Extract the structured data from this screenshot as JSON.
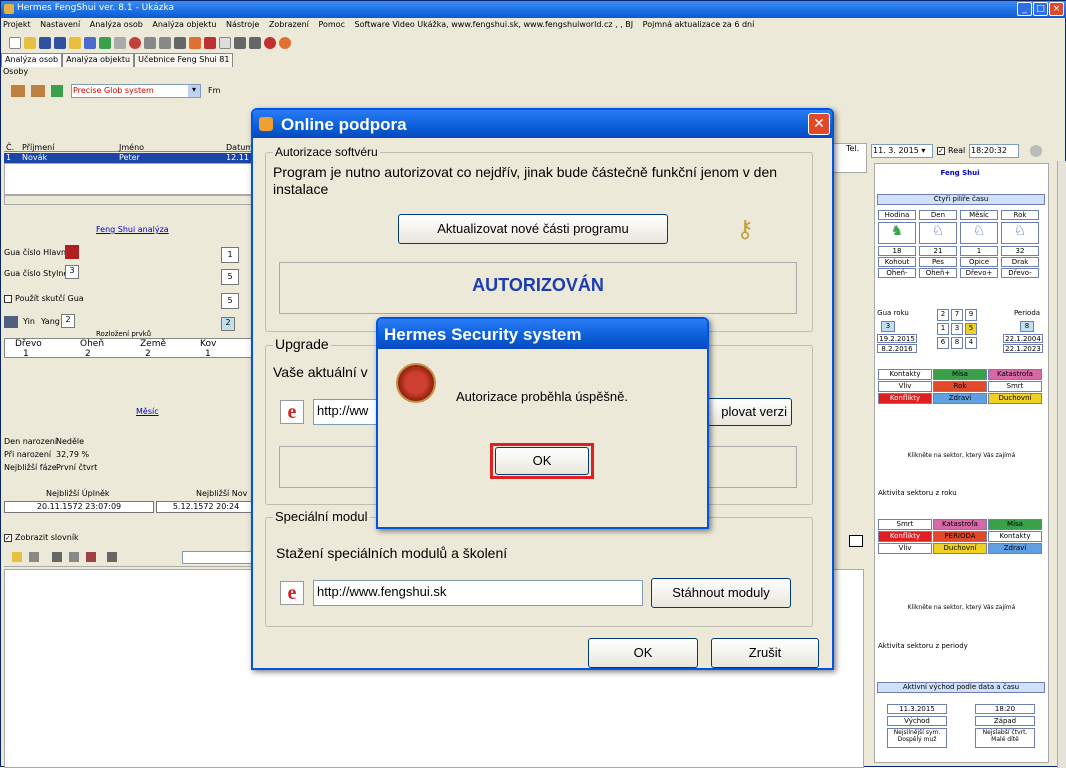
{
  "app": {
    "title": "Hermes FengShui ver. 8.1 - Ukázka",
    "menu": [
      "Projekt",
      "Nastavení",
      "Analýza osob",
      "Analýza objektu",
      "Nástroje",
      "Zobrazení",
      "Pomoc",
      "Software Video Ukážka, www.fengshui.sk, www.fengshuiworld.cz , , BJ",
      "Pojmná aktualizace za 6 dní"
    ],
    "tabs": [
      "Analýza osob",
      "Analýza objektu",
      "Učebnice Feng Shui 81"
    ],
    "group_label": "Osoby",
    "dropdown_value": "Precise Glob system",
    "fm": "Fm"
  },
  "persons": {
    "headers": [
      "Č.",
      "Příjmení",
      "Jméno",
      "Datum"
    ],
    "rows": [
      [
        "1",
        "Novák",
        "Peter",
        "12.11"
      ]
    ]
  },
  "left": {
    "fs_title": "Feng Shui analýza",
    "gua_main": "Gua číslo Hlavní",
    "gua_side": "Gua číslo Stylně",
    "gua_side_val": "3",
    "use_style": "Použít skutčí Gua",
    "yin": "Yin",
    "yang": "Yang",
    "yang_val": "2",
    "elements_label": "Rozložení prvků",
    "elements_headers": [
      "Dřevo",
      "Oheň",
      "Země",
      "Kov"
    ],
    "elements_values": [
      "1",
      "2",
      "2",
      "1"
    ],
    "side_nums": [
      "1",
      "5",
      "5",
      "2"
    ],
    "moon_title": "Měsíc",
    "day_born": "Den narození",
    "day_born_val": "Neděle",
    "at_birth": "Při narození",
    "at_birth_val": "32,79 %",
    "nearest": "Nejbližší fáze",
    "nearest_val": "První čtvrt",
    "nearest_full": "Nejbližší Úplněk",
    "nearest_new": "Nejbližší Nov",
    "full_val": "20.11.1572 23:07:09",
    "new_val": "5.12.1572 20:24",
    "show_notes": "Zobrazit slovník"
  },
  "online": {
    "title": "Online podpora",
    "auth_legend": "Autorizace softvéru",
    "auth_text": "Program je nutno autorizovat co nejdřív, jinak bude částečně funkční jenom v den instalace",
    "update_btn": "Aktualizovat nové části programu",
    "status": "AUTORIZOVÁN",
    "upgrade_legend": "Upgrade",
    "upgrade_text": "Vaše aktuální v",
    "upgrade_url": "http://ww",
    "upgrade_btn": "plovat verzi",
    "special_legend": "Speciální modul",
    "special_text": "Stažení speciálních modulů a školení",
    "special_url": "http://www.fengshui.sk",
    "download_btn": "Stáhnout moduly",
    "ok": "OK",
    "cancel": "Zrušit"
  },
  "hermes": {
    "title": "Hermes Security system",
    "message": "Autorizace proběhla úspěšně.",
    "ok": "OK"
  },
  "right": {
    "date": "11. 3. 2015",
    "real": "Real",
    "time": "18:20:32",
    "fs_title": "Feng Shui",
    "four_pillars": "Čtyři pilíře času",
    "pillar_headers": [
      "Hodina",
      "Den",
      "Měsíc",
      "Rok"
    ],
    "pillar_nums": [
      "18",
      "21",
      "1",
      "32"
    ],
    "pillar_animals": [
      "Kohout",
      "Pes",
      "Opice",
      "Drak"
    ],
    "pillar_elements": [
      "Oheň-",
      "Oheň+",
      "Dřevo+",
      "Dřevo-"
    ],
    "year_gua": "Gua roku",
    "year_gua_val": "3",
    "period": "Perioda",
    "period_val": "8",
    "grid1": [
      "2",
      "7",
      "9"
    ],
    "grid2": [
      "1",
      "3",
      "5"
    ],
    "grid3": [
      "6",
      "8",
      "4"
    ],
    "dates_left": [
      "19.2.2015",
      "8.2.2016"
    ],
    "dates_right": [
      "22.1.2004",
      "22.1.2023"
    ],
    "stars1": [
      "Kontakty",
      "Mísa",
      "Katastrofa"
    ],
    "stars2": [
      "Vliv",
      "Rok",
      "Smrt"
    ],
    "stars3": [
      "Konflikty",
      "Zdraví",
      "Duchovní"
    ],
    "choose_sector": "Klikněte na sektor, který Vás zajímá",
    "year_sector": "Aktivita sektoru z roku",
    "stars4": [
      "Smrt",
      "Katastrofa",
      "Mísa"
    ],
    "stars5": [
      "Konflikty",
      "PERIODA",
      "Kontakty"
    ],
    "stars6": [
      "Vliv",
      "Duchovní",
      "Zdraví"
    ],
    "period_sector": "Aktivita sektoru z periody",
    "sunrise": "Aktivní východ podle data a času",
    "sun_date": "11.3.2015",
    "sun_time": "18:20",
    "east": "Východ",
    "west": "Západ",
    "useful1": "Nejsilnější sym. Dospělý muž",
    "useful2": "Nejslabší čtvrt. Malé dítě"
  },
  "colors": {
    "accent": "#0a5ed6",
    "red": "#e04a2a",
    "green": "#3aa04a",
    "yellow": "#f0d020"
  }
}
